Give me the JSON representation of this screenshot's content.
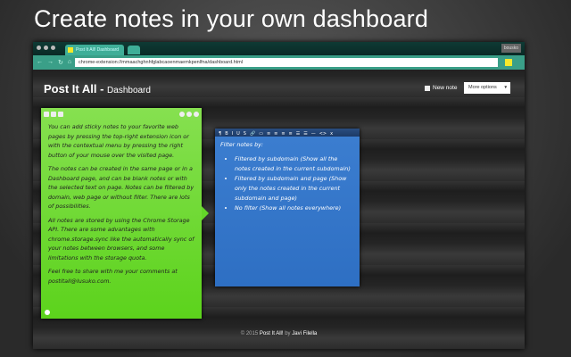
{
  "headline": "Create notes in your own dashboard",
  "browser": {
    "tab_title": "Post It All! Dashboard",
    "user": "bousko",
    "url": "chrome-extension://mmaachghnhfglabcaoenmaemkpenlfna/dashboard.html"
  },
  "header": {
    "brand": "Post It All -",
    "subtitle": "Dashboard",
    "new_note": "New note",
    "more_options": "More options"
  },
  "green_note": {
    "paragraphs": [
      "You can add sticky notes to your favorite web pages by pressing the top-right extension icon or with the contextual menu by pressing the right button of your mouse over the visited page.",
      "The notes can be created in the same page or in a Dashboard page, and can be blank notes or with the selected text on page. Notes can be filtered by domain, web page or without filter. There are lots of possibilities.",
      "All notes are stored by using the Chrome Storage API. There are some advantages with chrome.storage.sync like the automatically sync of your notes between browsers, and some limitations with the storage quota.",
      "Feel free to share with me your comments at postitall@lusuko.com."
    ]
  },
  "blue_note": {
    "toolbar": [
      "¶",
      "B",
      "I",
      "U",
      "S",
      "🔗",
      "▭",
      "≡",
      "≡",
      "≡",
      "≡",
      "☰",
      "☰",
      "—",
      "<>",
      "x"
    ],
    "title": "Filter notes by:",
    "items": [
      "Filtered by subdomain (Show all the notes created in the current subdomain)",
      "Filtered by subdomain and page (Show only the notes created in the current subdomain and page)",
      "No filter (Show all notes everywhere)"
    ]
  },
  "footer": {
    "copyright": "© 2015",
    "app": "Post It All!",
    "by": "by",
    "author": "Javi Filella"
  }
}
